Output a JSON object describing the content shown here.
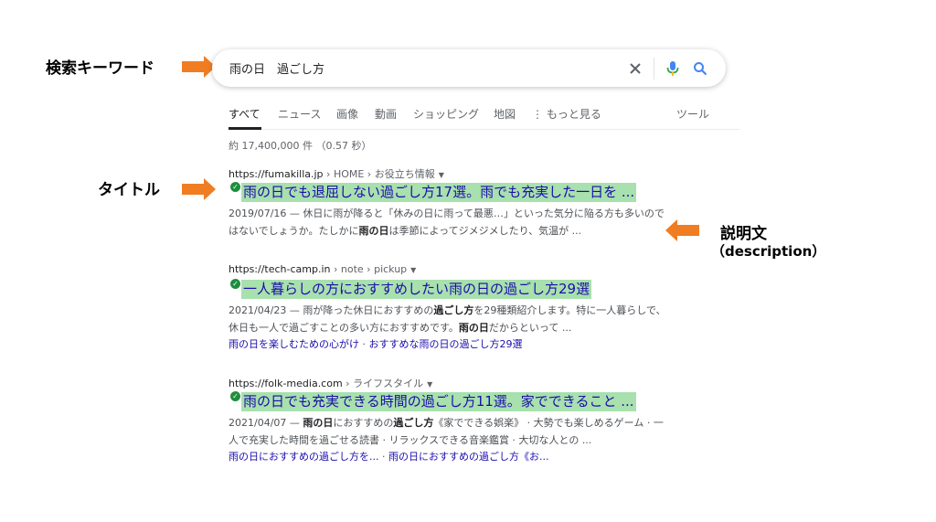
{
  "annotations": {
    "keyword_label": "検索キーワード",
    "title_label": "タイトル",
    "description_label": "説明文",
    "description_sub": "（description）",
    "arrow_color": "#f07d22"
  },
  "search": {
    "query": "雨の日　過ごし方",
    "clear_icon": "close-icon",
    "mic_icon": "mic-icon",
    "search_icon": "search-icon"
  },
  "tabs": [
    {
      "label": "すべて",
      "active": true
    },
    {
      "label": "ニュース"
    },
    {
      "label": "画像"
    },
    {
      "label": "動画"
    },
    {
      "label": "ショッピング"
    },
    {
      "label": "地図"
    },
    {
      "label": "⋮ もっと見る"
    },
    {
      "label": "ツール"
    }
  ],
  "stats": "約 17,400,000 件 （0.57 秒）",
  "results": [
    {
      "site": "https://fumakilla.jp",
      "path": " › HOME › お役立ち情報",
      "title": "雨の日でも退屈しない過ごし方17選。雨でも充実した一日を ...",
      "snippet_1": "2019/07/16 — 休日に雨が降ると「休みの日に雨って最悪…」といった気分に陥る方も多いので",
      "snippet_2a": "はないでしょうか。たしかに",
      "snippet_2b": "雨の日",
      "snippet_2c": "は季節によってジメジメしたり、気温が ..."
    },
    {
      "site": "https://tech-camp.in",
      "path": " › note › pickup",
      "title": "一人暮らしの方におすすめしたい雨の日の過ごし方29選",
      "snippet_1a": "2021/04/23 — 雨が降った休日におすすめの",
      "snippet_1b": "過ごし方",
      "snippet_1c": "を29種類紹介します。特に一人暮らしで、",
      "snippet_2a": "休日も一人で過ごすことの多い方におすすめです。",
      "snippet_2b": "雨の日",
      "snippet_2c": "だからといって ...",
      "sitelink_1": "雨の日を楽しむための心がけ",
      "sitelink_sep": " · ",
      "sitelink_2": "おすすめな雨の日の過ごし方29選"
    },
    {
      "site": "https://folk-media.com",
      "path": " › ライフスタイル",
      "title": "雨の日でも充実できる時間の過ごし方11選。家でできること ...",
      "snippet_1a": "2021/04/07 — ",
      "snippet_1b": "雨の日",
      "snippet_1c": "におすすめの",
      "snippet_1d": "過ごし方",
      "snippet_1e": "《家でできる娯楽》 · 大勢でも楽しめるゲーム · 一",
      "snippet_2": "人で充実した時間を過ごせる読書 · リラックスできる音楽鑑賞 · 大切な人との ...",
      "sitelink_1": "雨の日におすすめの過ごし方を...",
      "sitelink_sep": " · ",
      "sitelink_2": "雨の日におすすめの過ごし方《お..."
    }
  ]
}
